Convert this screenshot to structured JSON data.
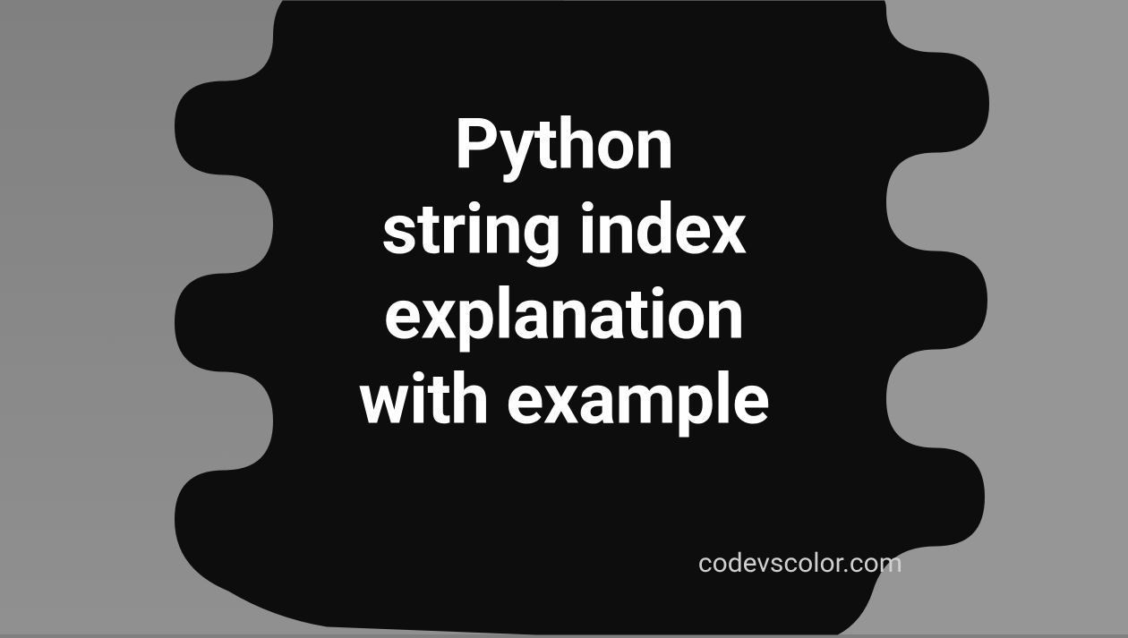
{
  "title_line1": "Python",
  "title_line2": "string index",
  "title_line3": "explanation",
  "title_line4": "with example",
  "watermark": "codevscolor.com",
  "colors": {
    "blob": "#0d0d0d",
    "text": "#ffffff",
    "watermark": "#d0d0d0",
    "bg_left": "#808080",
    "bg_right": "#969696"
  }
}
